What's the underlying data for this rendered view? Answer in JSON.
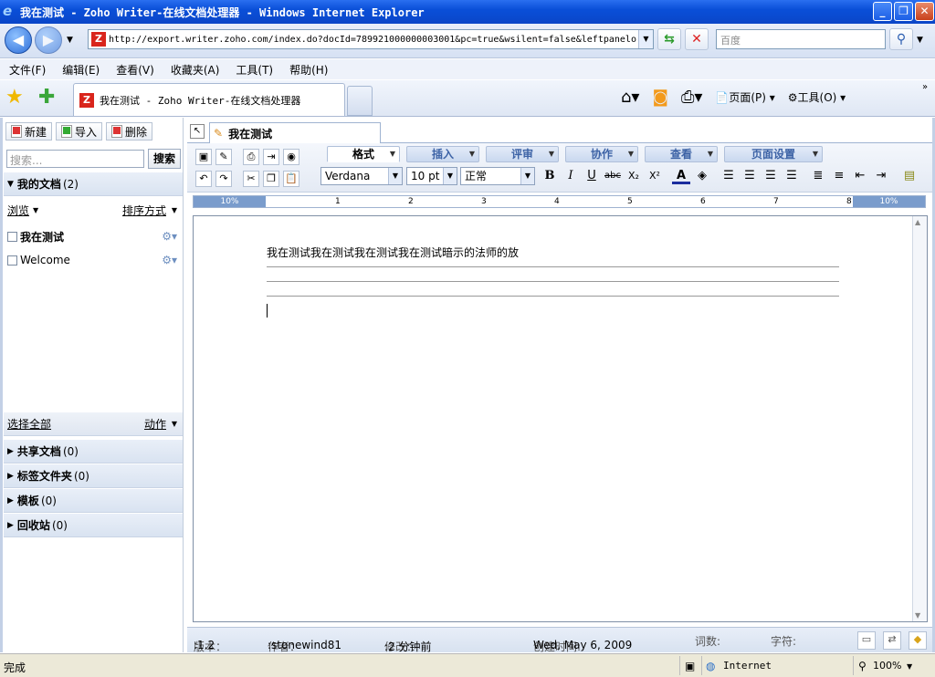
{
  "window": {
    "title": "我在测试 - Zoho Writer-在线文档处理器 - Windows Internet Explorer"
  },
  "browser": {
    "url": "http://export.writer.zoho.com/index.do?docId=789921000000003001&pc=true&wsilent=false&leftpanelo",
    "search_placeholder": "百度",
    "menu": [
      "文件(F)",
      "编辑(E)",
      "查看(V)",
      "收藏夹(A)",
      "工具(T)",
      "帮助(H)"
    ],
    "tab_title": "我在测试 - Zoho Writer-在线文档处理器",
    "page_label": "页面(P)",
    "tools_label": "工具(O)"
  },
  "sidebar": {
    "new_label": "新建",
    "import_label": "导入",
    "delete_label": "删除",
    "search_placeholder": "搜索...",
    "search_button": "搜索",
    "my_docs": "我的文档",
    "my_docs_count": "(2)",
    "browse": "浏览",
    "sort": "排序方式",
    "docs": [
      {
        "name": "我在测试"
      },
      {
        "name": "Welcome"
      }
    ],
    "select_all": "选择全部",
    "actions": "动作",
    "sections": [
      {
        "label": "共享文档",
        "count": "(0)"
      },
      {
        "label": "标签文件夹",
        "count": "(0)"
      },
      {
        "label": "模板",
        "count": "(0)"
      },
      {
        "label": "回收站",
        "count": "(0)"
      }
    ]
  },
  "editor": {
    "doc_tab": "我在测试",
    "ribbon_tabs": [
      "格式",
      "插入",
      "评审",
      "协作",
      "查看",
      "页面设置"
    ],
    "font": "Verdana",
    "size": "10 pt",
    "style": "正常",
    "ruler_left": "10%",
    "ruler_right": "10%",
    "ruler_nums": [
      "1",
      "2",
      "3",
      "4",
      "5",
      "6",
      "7",
      "8"
    ],
    "text": "我在测试我在测试我在测试我在测试暗示的法师的放"
  },
  "footer": {
    "version_label": "版本：",
    "version": ":1.2",
    "author_label": "作者：",
    "author": ":stonewind81",
    "modified_label": "修改：",
    "modified": ":2 分钟前",
    "created_label": "创建时间:",
    "created": "Wed, May 6, 2009",
    "words_label": "词数:",
    "chars_label": "字符:"
  },
  "status": {
    "left": "完成",
    "zone": "Internet",
    "zoom": "100%"
  }
}
